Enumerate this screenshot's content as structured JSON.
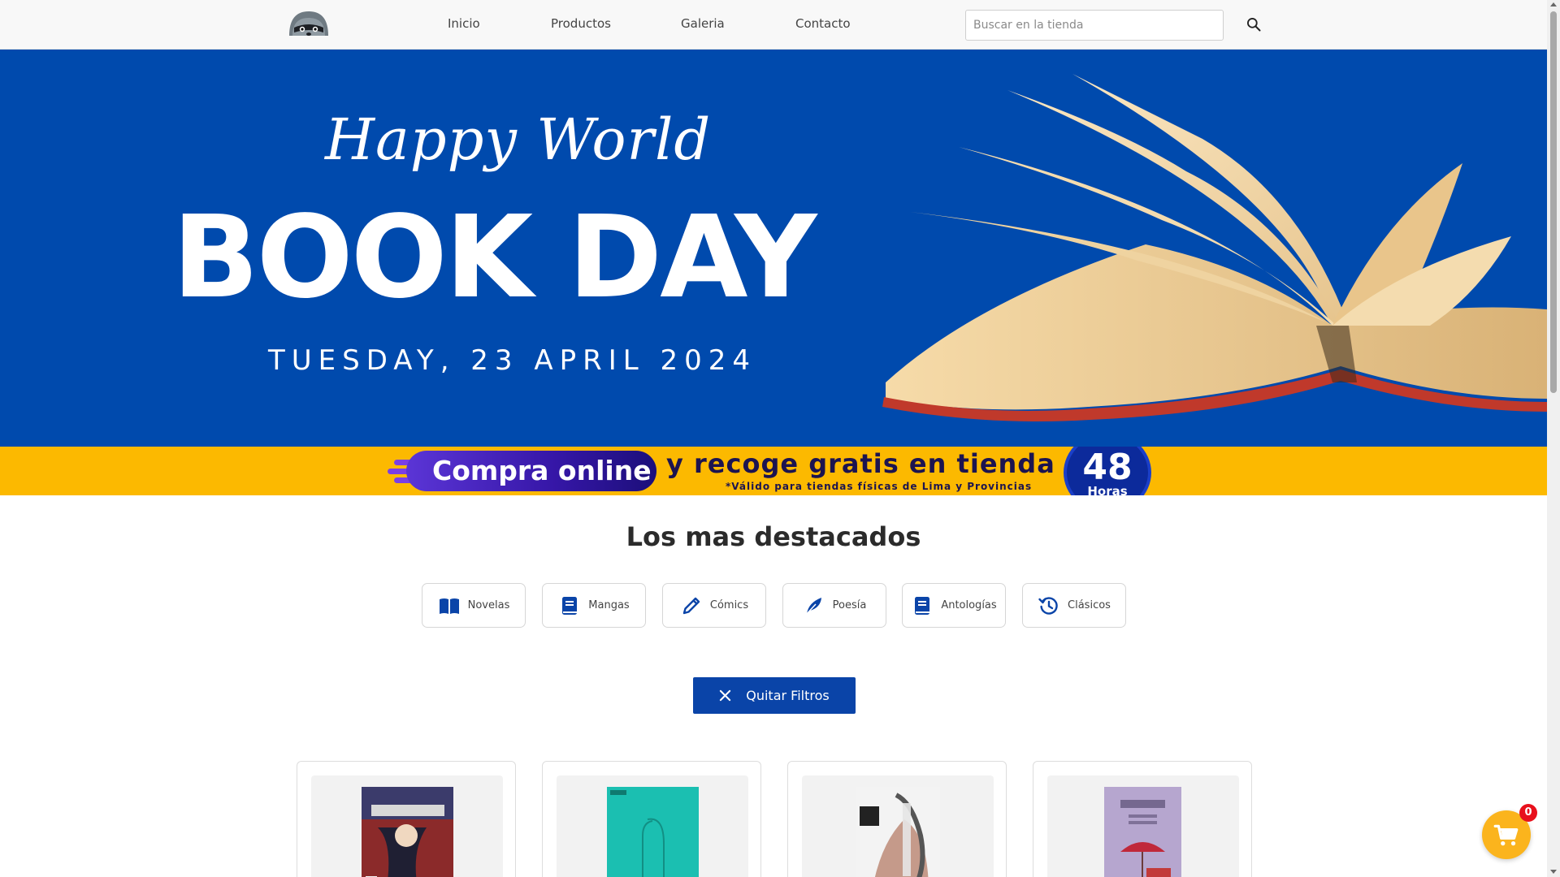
{
  "nav": {
    "logo_icon": "raccoon-logo-icon",
    "links": [
      "Inicio",
      "Productos",
      "Galeria",
      "Contacto"
    ],
    "search_placeholder": "Buscar en la tienda",
    "search_value": "",
    "search_icon": "search-icon"
  },
  "hero": {
    "script": "Happy World",
    "title": "BOOK DAY",
    "date": "TUESDAY, 23 APRIL 2024",
    "bg_color": "#004aad"
  },
  "promo": {
    "pill": "Compra online",
    "text": "y recoge gratis en tienda en",
    "note": "*Válido para tiendas físicas de Lima y Provincias",
    "badge_number": "48",
    "badge_unit": "Horas",
    "bg_color": "#fcb900"
  },
  "section": {
    "title": "Los mas destacados"
  },
  "categories": [
    {
      "label": "Novelas",
      "icon": "open-book-icon"
    },
    {
      "label": "Mangas",
      "icon": "book-icon"
    },
    {
      "label": "Cómics",
      "icon": "pencil-icon"
    },
    {
      "label": "Poesía",
      "icon": "feather-icon"
    },
    {
      "label": "Antologías",
      "icon": "book-icon"
    },
    {
      "label": "Clásicos",
      "icon": "history-icon"
    }
  ],
  "clear_filters": {
    "label": "Quitar Filtros",
    "icon": "close-icon",
    "color": "#0a44a8"
  },
  "cart": {
    "count": "0",
    "icon": "cart-icon"
  }
}
